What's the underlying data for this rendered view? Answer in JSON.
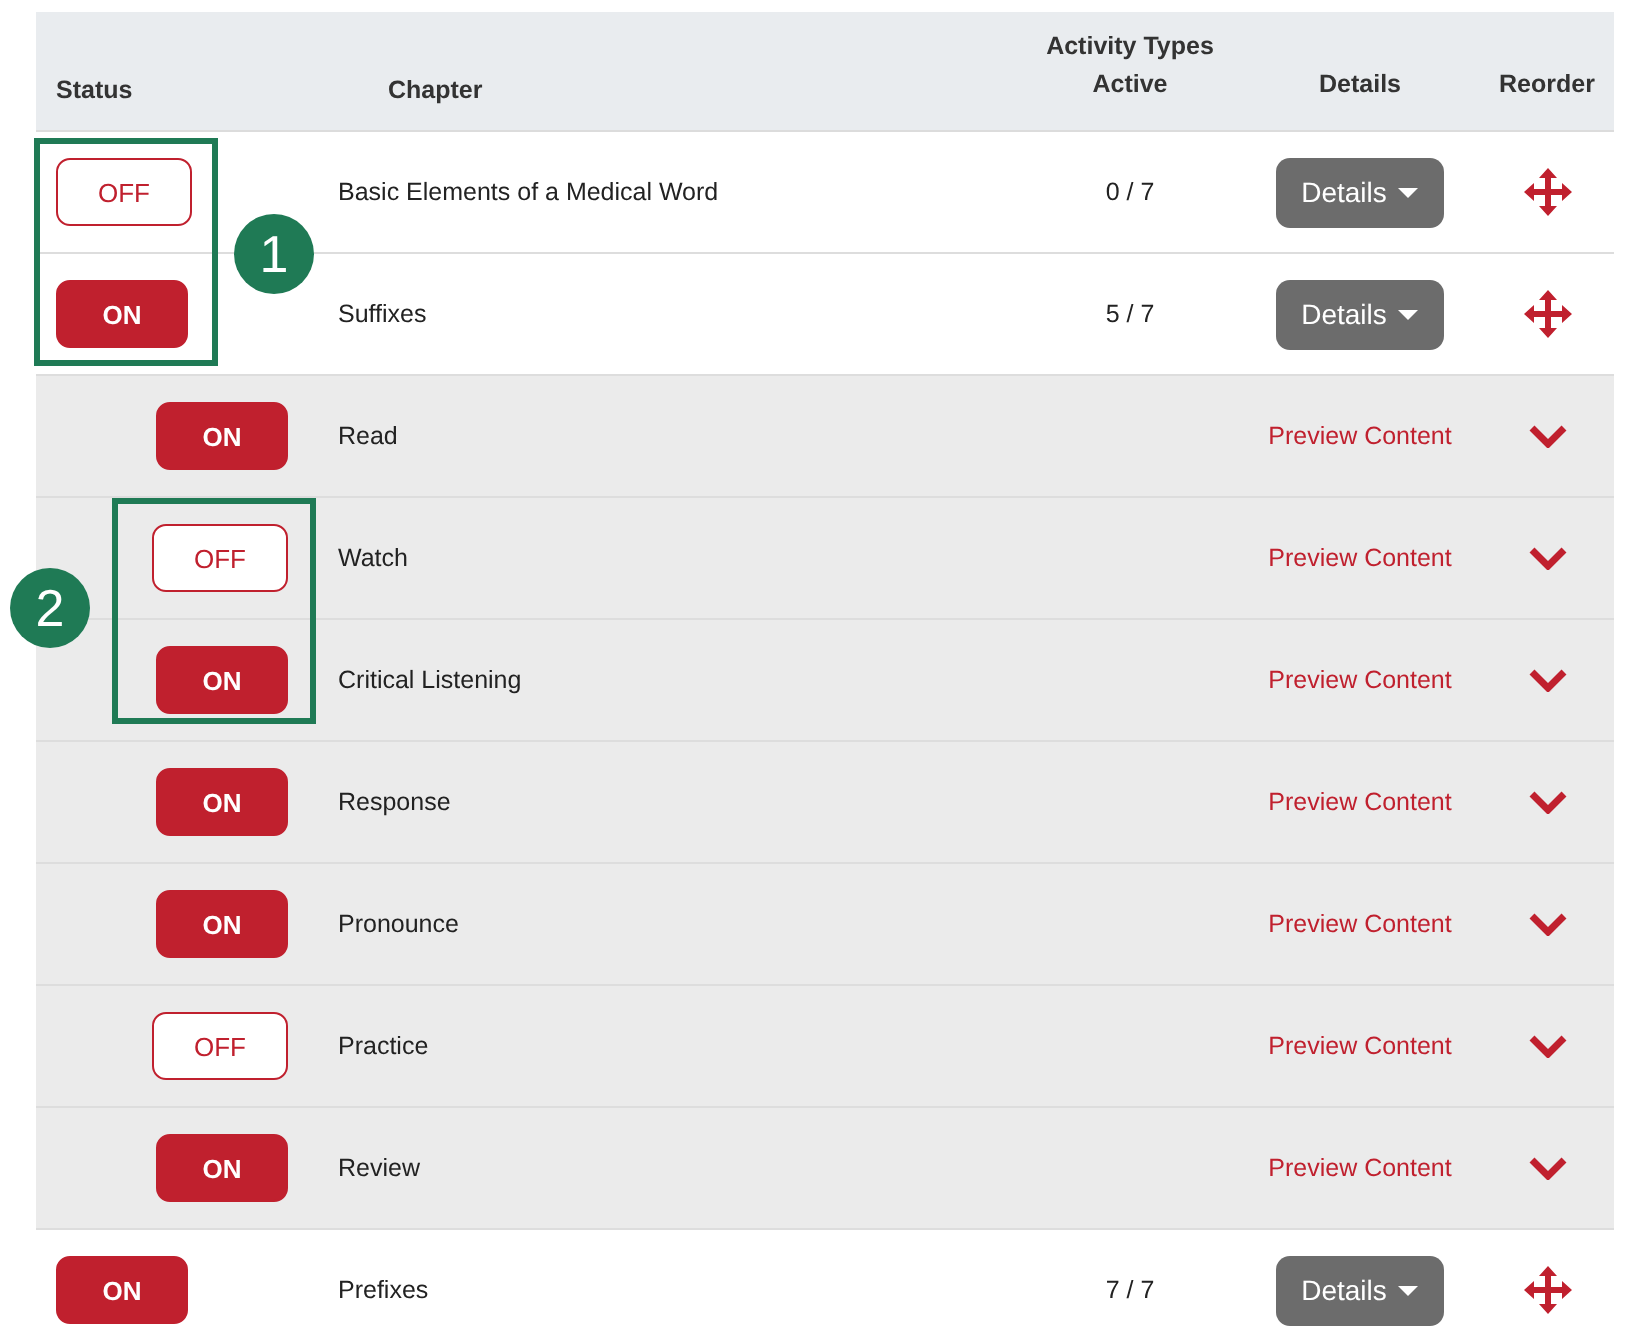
{
  "table": {
    "columns": [
      "Status",
      "Chapter",
      "Activity Types Active",
      "Details",
      "Reorder"
    ],
    "rows": [
      {
        "kind": "chapter",
        "on": false,
        "toggle": "OFF",
        "name": "Basic Elements of a Medical Word",
        "active": "0 / 7",
        "action": "Details"
      },
      {
        "kind": "chapter",
        "on": true,
        "toggle": "ON",
        "name": "Suffixes",
        "active": "5 / 7",
        "action": "Details"
      },
      {
        "kind": "activity",
        "on": true,
        "toggle": "ON",
        "name": "Read",
        "action": "Preview Content"
      },
      {
        "kind": "activity",
        "on": false,
        "toggle": "OFF",
        "name": "Watch",
        "action": "Preview Content"
      },
      {
        "kind": "activity",
        "on": true,
        "toggle": "ON",
        "name": "Critical Listening",
        "action": "Preview Content"
      },
      {
        "kind": "activity",
        "on": true,
        "toggle": "ON",
        "name": "Response",
        "action": "Preview Content"
      },
      {
        "kind": "activity",
        "on": true,
        "toggle": "ON",
        "name": "Pronounce",
        "action": "Preview Content"
      },
      {
        "kind": "activity",
        "on": false,
        "toggle": "OFF",
        "name": "Practice",
        "action": "Preview Content"
      },
      {
        "kind": "activity",
        "on": true,
        "toggle": "ON",
        "name": "Review",
        "action": "Preview Content"
      },
      {
        "kind": "chapter",
        "on": true,
        "toggle": "ON",
        "name": "Prefixes",
        "active": "7 / 7",
        "action": "Details"
      }
    ]
  },
  "callouts": [
    {
      "label": "1"
    },
    {
      "label": "2"
    }
  ]
}
